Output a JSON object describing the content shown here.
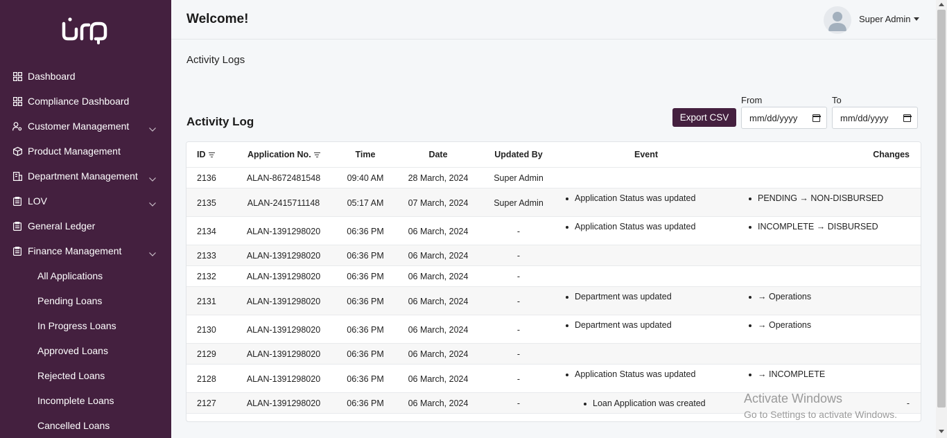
{
  "app": {
    "logo_text": "عون"
  },
  "sidebar": {
    "items": [
      {
        "label": "Dashboard",
        "icon": "grid-icon",
        "expandable": false
      },
      {
        "label": "Compliance Dashboard",
        "icon": "grid-icon",
        "expandable": false
      },
      {
        "label": "Customer Management",
        "icon": "user-gear-icon",
        "expandable": true
      },
      {
        "label": "Product Management",
        "icon": "box-icon",
        "expandable": false
      },
      {
        "label": "Department Management",
        "icon": "building-icon",
        "expandable": true
      },
      {
        "label": "LOV",
        "icon": "clipboard-icon",
        "expandable": true
      },
      {
        "label": "General Ledger",
        "icon": "clipboard-icon",
        "expandable": false
      },
      {
        "label": "Finance Management",
        "icon": "clipboard-icon",
        "expandable": true
      }
    ],
    "sub_items": [
      "All Applications",
      "Pending Loans",
      "In Progress Loans",
      "Approved Loans",
      "Rejected Loans",
      "Incomplete Loans",
      "Cancelled Loans"
    ]
  },
  "header": {
    "welcome": "Welcome!",
    "user_name": "Super Admin"
  },
  "breadcrumb": "Activity Logs",
  "section_title": "Activity Log",
  "toolbar": {
    "export_label": "Export CSV",
    "from_label": "From",
    "to_label": "To",
    "from_placeholder": "mm/dd/yyyy",
    "to_placeholder": "mm/dd/yyyy"
  },
  "table": {
    "columns": [
      "ID",
      "Application No.",
      "Time",
      "Date",
      "Updated By",
      "Event",
      "Changes"
    ],
    "rows": [
      {
        "id": "2136",
        "app_no": "ALAN-8672481548",
        "time": "09:40 AM",
        "date": "28 March, 2024",
        "updated_by": "Super Admin",
        "event": "",
        "changes": ""
      },
      {
        "id": "2135",
        "app_no": "ALAN-2415711148",
        "time": "05:17 AM",
        "date": "07 March, 2024",
        "updated_by": "Super Admin",
        "event": "Application Status was updated",
        "changes": "PENDING → NON-DISBURSED"
      },
      {
        "id": "2134",
        "app_no": "ALAN-1391298020",
        "time": "06:36 PM",
        "date": "06 March, 2024",
        "updated_by": "-",
        "event": "Application Status was updated",
        "changes": "INCOMPLETE → DISBURSED"
      },
      {
        "id": "2133",
        "app_no": "ALAN-1391298020",
        "time": "06:36 PM",
        "date": "06 March, 2024",
        "updated_by": "-",
        "event": "",
        "changes": ""
      },
      {
        "id": "2132",
        "app_no": "ALAN-1391298020",
        "time": "06:36 PM",
        "date": "06 March, 2024",
        "updated_by": "-",
        "event": "",
        "changes": ""
      },
      {
        "id": "2131",
        "app_no": "ALAN-1391298020",
        "time": "06:36 PM",
        "date": "06 March, 2024",
        "updated_by": "-",
        "event": "Department was updated",
        "changes": "→ Operations"
      },
      {
        "id": "2130",
        "app_no": "ALAN-1391298020",
        "time": "06:36 PM",
        "date": "06 March, 2024",
        "updated_by": "-",
        "event": "Department was updated",
        "changes": "→ Operations"
      },
      {
        "id": "2129",
        "app_no": "ALAN-1391298020",
        "time": "06:36 PM",
        "date": "06 March, 2024",
        "updated_by": "-",
        "event": "",
        "changes": ""
      },
      {
        "id": "2128",
        "app_no": "ALAN-1391298020",
        "time": "06:36 PM",
        "date": "06 March, 2024",
        "updated_by": "-",
        "event": "Application Status was updated",
        "changes": "→ INCOMPLETE"
      },
      {
        "id": "2127",
        "app_no": "ALAN-1391298020",
        "time": "06:36 PM",
        "date": "06 March, 2024",
        "updated_by": "-",
        "event": "Loan Application was created",
        "changes": "-"
      }
    ]
  },
  "watermark": {
    "line1": "Activate Windows",
    "line2": "Go to Settings to activate Windows."
  },
  "colors": {
    "sidebar_bg": "#44203f",
    "accent": "#44203f"
  }
}
